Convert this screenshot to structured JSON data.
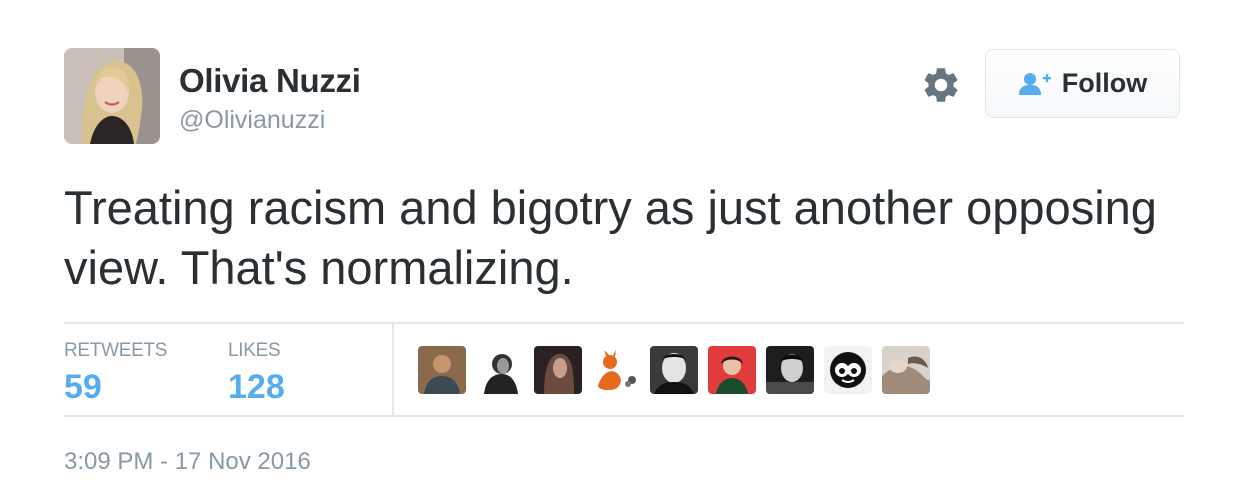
{
  "author": {
    "name": "Olivia Nuzzi",
    "handle": "@Olivianuzzi"
  },
  "actions": {
    "follow_label": "Follow"
  },
  "tweet": {
    "text": "Treating racism and bigotry as just another opposing view. That's normalizing.",
    "timestamp": "3:09 PM - 17 Nov 2016"
  },
  "stats": {
    "retweets_label": "RETWEETS",
    "retweets_count": "59",
    "likes_label": "LIKES",
    "likes_count": "128"
  },
  "colors": {
    "text": "#292f33",
    "secondary": "#8899a6",
    "accent": "#55acee",
    "border": "#e1e8ed"
  },
  "icons": {
    "settings": "gear-icon",
    "follow": "person-plus-icon"
  }
}
